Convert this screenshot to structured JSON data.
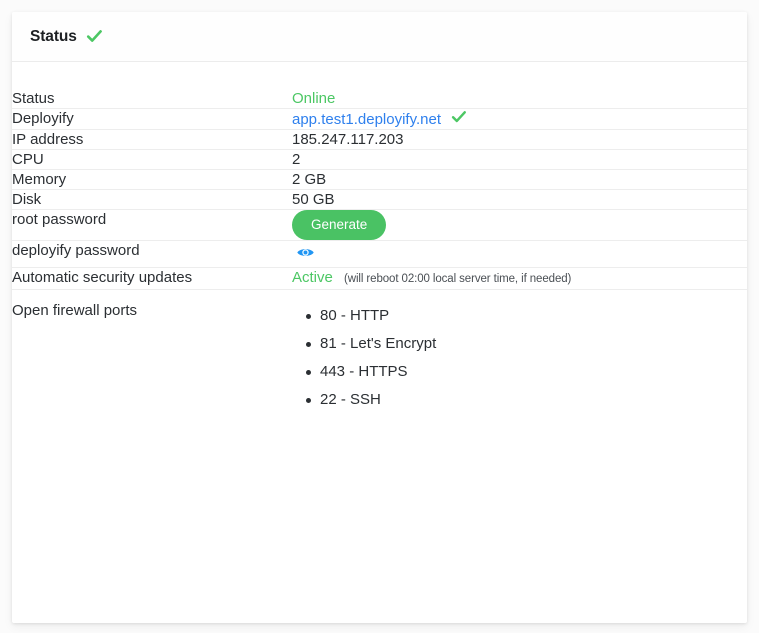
{
  "card": {
    "header": {
      "title": "Status",
      "status_icon": "green-check-icon"
    },
    "rows": [
      {
        "label": "Status",
        "value": "Online"
      },
      {
        "label": "Deployify",
        "value": "app.test1.deployify.net",
        "icon": "green-check-icon"
      },
      {
        "label": "IP address",
        "value": "185.247.117.203"
      },
      {
        "label": "CPU",
        "value": "2"
      },
      {
        "label": "Memory",
        "value": "2 GB"
      },
      {
        "label": "Disk",
        "value": "50 GB"
      },
      {
        "label": "root password",
        "value": "Generate"
      },
      {
        "label": "deployify password",
        "value": "",
        "icon": "eye-icon"
      },
      {
        "label": "Automatic security updates",
        "value": "Active",
        "note": "(will reboot 02:00 local server time, if needed)"
      },
      {
        "label": "Open firewall ports",
        "value": ""
      }
    ],
    "firewall_ports": [
      "80 - HTTP",
      "81 - Let's Encrypt",
      "443 - HTTPS",
      "22 - SSH"
    ]
  },
  "colors": {
    "green": "#4cc764",
    "button_green": "#4ac264",
    "link_blue": "#2f80ed",
    "eye_blue": "#2196f3",
    "text": "#2b2f33",
    "divider": "#ededed"
  }
}
